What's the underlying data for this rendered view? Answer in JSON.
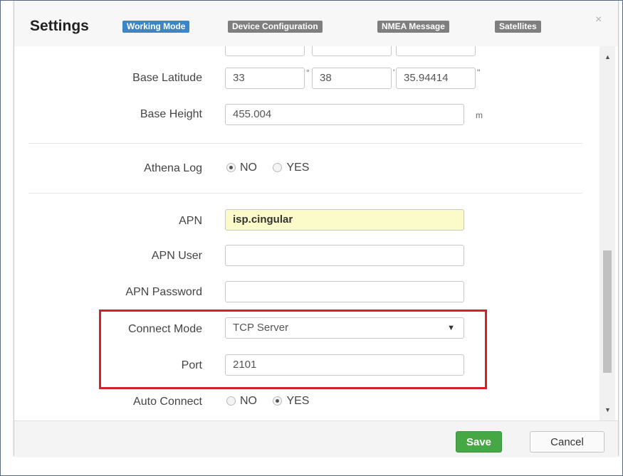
{
  "dialog": {
    "title": "Settings",
    "tabs": [
      {
        "label": "Working Mode"
      },
      {
        "label": "Device Configuration"
      },
      {
        "label": "NMEA Message"
      },
      {
        "label": "Satellites"
      }
    ],
    "close_icon": "×"
  },
  "form": {
    "base_latitude": {
      "label": "Base Latitude",
      "deg": "33",
      "deg_unit": "°",
      "min": "38",
      "min_unit": "'",
      "sec": "35.94414",
      "sec_unit": "\""
    },
    "base_height": {
      "label": "Base Height",
      "value": "455.004",
      "unit": "m"
    },
    "athena_log": {
      "label": "Athena Log",
      "no": "NO",
      "yes": "YES",
      "selected": "NO"
    },
    "apn": {
      "label": "APN",
      "value": "isp.cingular"
    },
    "apn_user": {
      "label": "APN User",
      "value": ""
    },
    "apn_password": {
      "label": "APN Password",
      "value": ""
    },
    "connect_mode": {
      "label": "Connect Mode",
      "value": "TCP Server"
    },
    "port": {
      "label": "Port",
      "value": "2101"
    },
    "auto_connect": {
      "label": "Auto Connect",
      "no": "NO",
      "yes": "YES",
      "selected": "YES"
    }
  },
  "footer": {
    "save": "Save",
    "cancel": "Cancel"
  },
  "colors": {
    "active_tab": "#3a86c8",
    "inactive_tab": "#7f7f7f",
    "save_button": "#45a845",
    "highlight_box": "#d3222a",
    "apn_field": "#fbfbc9"
  },
  "icons": {
    "close": "close-icon",
    "select_caret": "chevron-down-icon",
    "scroll_up": "arrow-up-icon",
    "scroll_down": "arrow-down-icon"
  }
}
